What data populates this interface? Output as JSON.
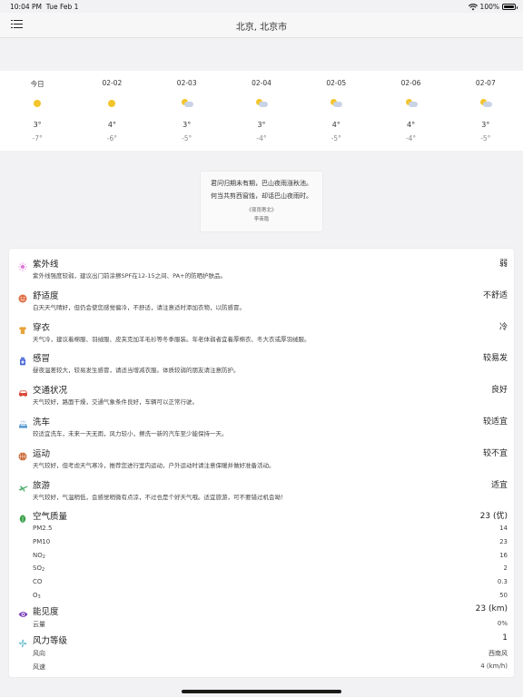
{
  "status": {
    "time": "10:04 PM",
    "date": "Tue Feb 1",
    "battery": "100%",
    "battery_level": 1.0
  },
  "nav": {
    "title": "北京, 北京市"
  },
  "forecast": [
    {
      "date": "今日",
      "icon": "sun-icon",
      "high": "3°",
      "low": "-7°"
    },
    {
      "date": "02-02",
      "icon": "sun-icon",
      "high": "4°",
      "low": "-6°"
    },
    {
      "date": "02-03",
      "icon": "partly-cloudy-icon",
      "high": "3°",
      "low": "-5°"
    },
    {
      "date": "02-04",
      "icon": "partly-cloudy-icon",
      "high": "3°",
      "low": "-4°"
    },
    {
      "date": "02-05",
      "icon": "partly-cloudy-icon",
      "high": "4°",
      "low": "-5°"
    },
    {
      "date": "02-06",
      "icon": "partly-cloudy-icon",
      "high": "4°",
      "low": "-4°"
    },
    {
      "date": "02-07",
      "icon": "partly-cloudy-icon",
      "high": "3°",
      "low": "-5°"
    }
  ],
  "poem": {
    "line1": "君问归期未有期，巴山夜雨涨秋池。",
    "line2": "何当共剪西窗烛，却话巴山夜雨时。",
    "title": "《夜雨寄北》",
    "author": "李商隐"
  },
  "indices": [
    {
      "name": "紫外线",
      "value": "弱",
      "desc": "紫外线强度较弱，建议出门前涂擦SPF在12-15之间、PA+的防晒护肤品。",
      "icon": "uv-sun-icon",
      "color": "#e07ad8"
    },
    {
      "name": "舒适度",
      "value": "不舒适",
      "desc": "白天天气晴好，但仍会使您感觉偏冷，不舒适，请注意适时添加衣物，以防感冒。",
      "icon": "comfort-face-icon",
      "color": "#e0724a"
    },
    {
      "name": "穿衣",
      "value": "冷",
      "desc": "天气冷，建议着棉服、羽绒服、皮夹克加羊毛衫等冬季服装。年老体弱者宜着厚棉衣、冬大衣或厚羽绒服。",
      "icon": "clothing-icon",
      "color": "#e8a33a"
    },
    {
      "name": "感冒",
      "value": "较易发",
      "desc": "昼夜温差较大，较易发生感冒，请适当增减衣服。体质较弱的朋友请注意防护。",
      "icon": "medicine-icon",
      "color": "#4a6ad8"
    },
    {
      "name": "交通状况",
      "value": "良好",
      "desc": "天气较好，路面干燥，交通气象条件良好，车辆可以正常行驶。",
      "icon": "car-icon",
      "color": "#d84a3a"
    },
    {
      "name": "洗车",
      "value": "较适宜",
      "desc": "较适宜洗车，未来一天无雨，风力较小，擦洗一新的汽车至少能保持一天。",
      "icon": "car-wash-icon",
      "color": "#5a9ad0"
    },
    {
      "name": "运动",
      "value": "较不宜",
      "desc": "天气较好，但考虑天气寒冷，推荐您进行室内运动，户外运动时请注意保暖并做好准备活动。",
      "icon": "basketball-icon",
      "color": "#c8602a"
    },
    {
      "name": "旅游",
      "value": "适宜",
      "desc": "天气较好，气温稍低，会感觉稍微有点凉，不过也是个好天气哦。适宜旅游，可不要错过机会呦！",
      "icon": "plane-icon",
      "color": "#4aaa6a"
    }
  ],
  "air": {
    "name": "空气质量",
    "value": "23 (优)",
    "icon": "leaf-icon",
    "color": "#3aa04a",
    "rows": [
      {
        "label": "PM2.5",
        "value": "14"
      },
      {
        "label": "PM10",
        "value": "23"
      },
      {
        "label": "NO",
        "label_sub": "2",
        "value": "16"
      },
      {
        "label": "SO",
        "label_sub": "2",
        "value": "2"
      },
      {
        "label": "CO",
        "value": "0.3"
      },
      {
        "label": "O",
        "label_sub": "3",
        "value": "50"
      }
    ]
  },
  "visibility": {
    "name": "能见度",
    "value": "23 (km)",
    "icon": "eye-icon",
    "color": "#7a3ab8",
    "rows": [
      {
        "label": "云量",
        "value": "0%"
      }
    ]
  },
  "wind": {
    "name": "风力等级",
    "value": "1",
    "icon": "wind-icon",
    "color": "#2aa0b8",
    "rows": [
      {
        "label": "风向",
        "value": "西南风"
      },
      {
        "label": "风速",
        "value": "4 (km/h)"
      }
    ]
  }
}
